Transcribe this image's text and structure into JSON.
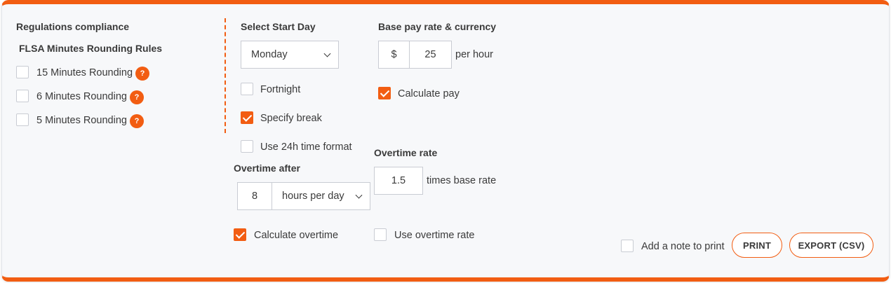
{
  "regulations": {
    "title": "Regulations compliance",
    "subtitle": "FLSA Minutes Rounding Rules",
    "options": [
      {
        "label": "15 Minutes Rounding",
        "checked": false,
        "help": "?"
      },
      {
        "label": "6 Minutes Rounding",
        "checked": false,
        "help": "?"
      },
      {
        "label": "5 Minutes Rounding",
        "checked": false,
        "help": "?"
      }
    ]
  },
  "start_day": {
    "title": "Select Start Day",
    "selected": "Monday"
  },
  "options": {
    "fortnight": {
      "label": "Fortnight",
      "checked": false
    },
    "specify_break": {
      "label": "Specify break",
      "checked": true
    },
    "use_24h": {
      "label": "Use 24h time format",
      "checked": false
    }
  },
  "base_pay": {
    "title": "Base pay rate & currency",
    "currency": "$",
    "rate": "25",
    "unit": "per hour",
    "calculate_pay": {
      "label": "Calculate pay",
      "checked": true
    }
  },
  "overtime_after": {
    "title": "Overtime after",
    "hours": "8",
    "period": "hours per day"
  },
  "overtime_rate": {
    "title": "Overtime rate",
    "value": "1.5",
    "unit": "times base rate"
  },
  "calculate_overtime": {
    "label": "Calculate overtime",
    "checked": true
  },
  "use_overtime_rate": {
    "label": "Use overtime rate",
    "checked": false
  },
  "footer": {
    "add_note": {
      "label": "Add a note to print",
      "checked": false
    },
    "print_label": "PRINT",
    "export_label": "EXPORT (CSV)"
  },
  "colors": {
    "accent": "#f25d12",
    "panel_bg": "#f7f8fa",
    "border": "#c9ccd3"
  }
}
